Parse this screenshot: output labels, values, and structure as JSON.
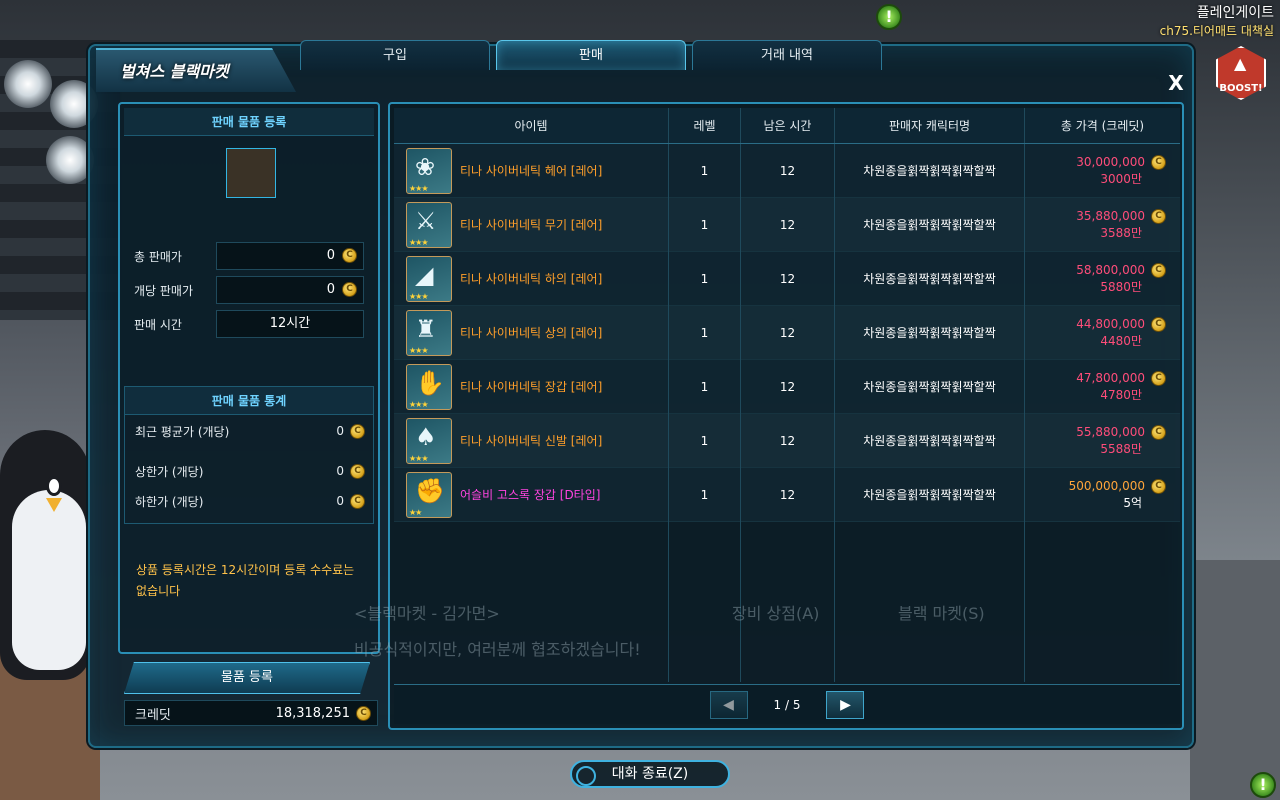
{
  "channel": {
    "name": "플레인게이트",
    "sub": "ch75.티어매트 대책실"
  },
  "boost": "BOOST!",
  "window": {
    "title": "벌쳐스 블랙마켓",
    "tabs": [
      "구입",
      "판매",
      "거래 내역"
    ],
    "active_tab": "판매",
    "close": "X"
  },
  "left": {
    "register_head": "판매 물품 등록",
    "fields": [
      {
        "label": "총 판매가",
        "value": "0"
      },
      {
        "label": "개당 판매가",
        "value": "0"
      },
      {
        "label": "판매 시간",
        "value": "12시간"
      }
    ],
    "stats_head": "판매 물품 통계",
    "stats": [
      {
        "label": "최근 평균가 (개당)",
        "value": "0"
      },
      {
        "label": "상한가 (개당)",
        "value": "0"
      },
      {
        "label": "하한가 (개당)",
        "value": "0"
      }
    ],
    "notice": "상품 등록시간은 12시간이며 등록 수수료는 없습니다",
    "register_button": "물품 등록",
    "credit_label": "크레딧",
    "credit_value": "18,318,251"
  },
  "table": {
    "headers": [
      "아이템",
      "레벨",
      "남은 시간",
      "판매자 캐릭터명",
      "총 가격 (크레딧)"
    ],
    "rows": [
      {
        "icon": "hair-icon",
        "name": "티나 사이버네틱 헤어 [레어]",
        "level": "1",
        "time": "12",
        "seller": "차원종을휡짝휡짝휡짝할짝",
        "price": "30,000,000",
        "price_short": "3000만"
      },
      {
        "icon": "weapon-icon",
        "name": "티나 사이버네틱 무기 [레어]",
        "level": "1",
        "time": "12",
        "seller": "차원종을휡짝휡짝휡짝할짝",
        "price": "35,880,000",
        "price_short": "3588만"
      },
      {
        "icon": "pants-icon",
        "name": "티나 사이버네틱 하의 [레어]",
        "level": "1",
        "time": "12",
        "seller": "차원종을휡짝휡짝휡짝할짝",
        "price": "58,800,000",
        "price_short": "5880만"
      },
      {
        "icon": "top-icon",
        "name": "티나 사이버네틱 상의 [레어]",
        "level": "1",
        "time": "12",
        "seller": "차원종을휡짝휡짝휡짝할짝",
        "price": "44,800,000",
        "price_short": "4480만"
      },
      {
        "icon": "gloves-icon",
        "name": "티나 사이버네틱 장갑 [레어]",
        "level": "1",
        "time": "12",
        "seller": "차원종을휡짝휡짝휡짝할짝",
        "price": "47,800,000",
        "price_short": "4780만"
      },
      {
        "icon": "shoes-icon",
        "name": "티나 사이버네틱 신발 [레어]",
        "level": "1",
        "time": "12",
        "seller": "차원종을휡짝휡짝휡짝할짝",
        "price": "55,880,000",
        "price_short": "5588만"
      },
      {
        "icon": "gauntlet-icon",
        "name": "어슬비 고스록 장갑 [D타입]",
        "level": "1",
        "time": "12",
        "seller": "차원종을휡짝휡짝휡짝할짝",
        "price": "500,000,000",
        "price_short": "5억"
      }
    ],
    "page": "1 / 5"
  },
  "background_text": {
    "title": "<블랙마켓 - 김가면>",
    "btn1": "장비 상점(A)",
    "btn2": "블랙 마켓(S)",
    "line": "비공식적이지만, 여러분께 협조하겠습니다!"
  },
  "end_button": "대화 종료(Z)"
}
